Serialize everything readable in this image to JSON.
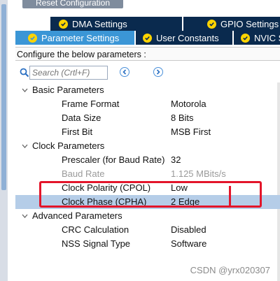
{
  "header": {
    "reset_label": "Reset Configuration"
  },
  "tabs_row1": [
    {
      "label": "DMA Settings"
    },
    {
      "label": "GPIO Settings"
    }
  ],
  "tabs_row2": [
    {
      "label": "Parameter Settings",
      "active": true
    },
    {
      "label": "User Constants"
    },
    {
      "label": "NVIC Se"
    }
  ],
  "configure_text": "Configure the below parameters :",
  "search": {
    "placeholder": "Search (Crtl+F)"
  },
  "groups": [
    {
      "name": "Basic Parameters",
      "params": [
        {
          "name": "Frame Format",
          "value": "Motorola"
        },
        {
          "name": "Data Size",
          "value": "8 Bits"
        },
        {
          "name": "First Bit",
          "value": "MSB First"
        }
      ]
    },
    {
      "name": "Clock Parameters",
      "params": [
        {
          "name": "Prescaler (for Baud Rate)",
          "value": "32"
        },
        {
          "name": "Baud Rate",
          "value": "1.125 MBits/s",
          "disabled": true
        },
        {
          "name": "Clock Polarity (CPOL)",
          "value": "Low"
        },
        {
          "name": "Clock Phase (CPHA)",
          "value": "2 Edge",
          "selected": true
        }
      ]
    },
    {
      "name": "Advanced Parameters",
      "params": [
        {
          "name": "CRC Calculation",
          "value": "Disabled"
        },
        {
          "name": "NSS Signal Type",
          "value": "Software"
        }
      ]
    }
  ],
  "watermark": "CSDN @yrx020307",
  "colors": {
    "tab_dark": "#0a2a4e",
    "tab_active": "#3b96d6",
    "selected_row": "#b5cde8",
    "annotation_red": "#e3152a",
    "check_yellow": "#ffd400"
  },
  "icons": [
    "check-icon",
    "search-icon",
    "chevron-left-icon",
    "chevron-right-icon",
    "caret-down-icon"
  ]
}
